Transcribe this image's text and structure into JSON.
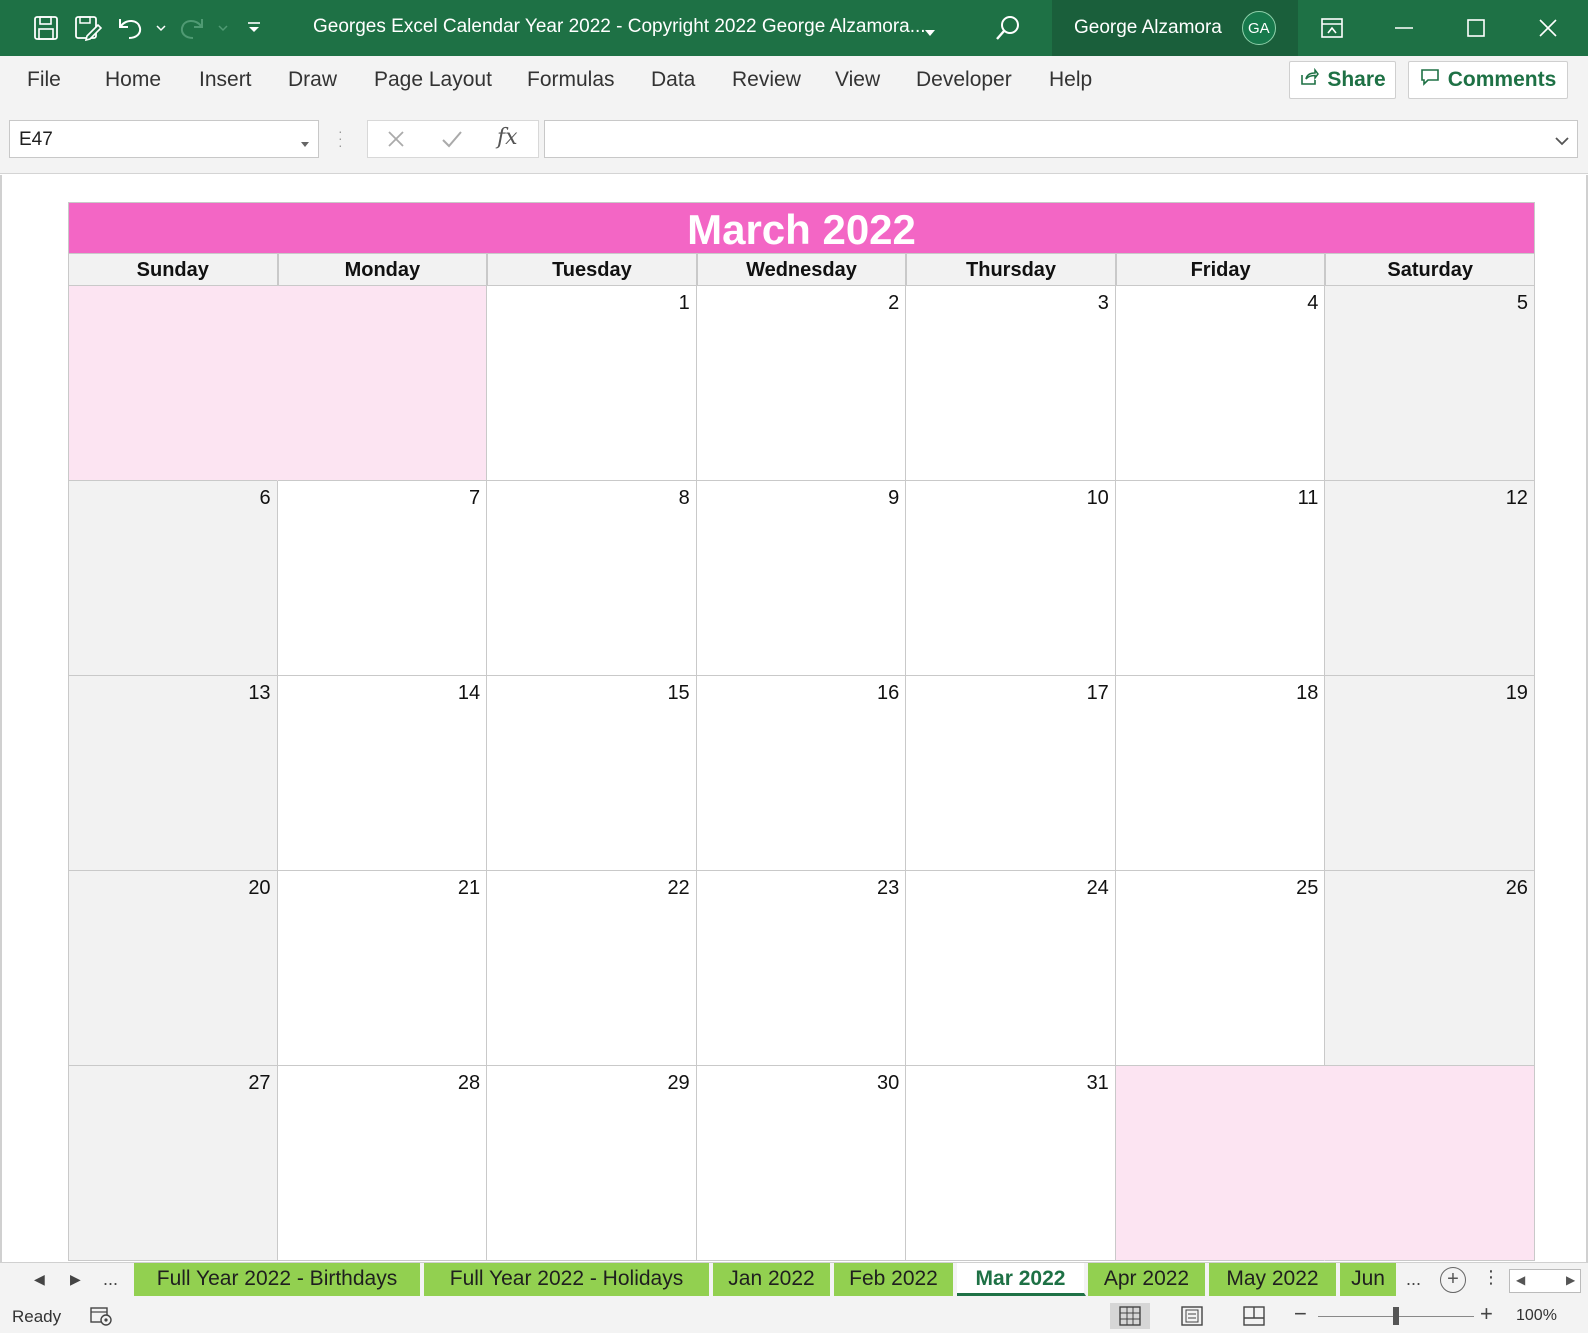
{
  "titlebar": {
    "document_title": "Georges Excel Calendar Year 2022 - Copyright 2022 George Alzamora...",
    "user_name": "George Alzamora",
    "user_initials": "GA",
    "qat_icons": [
      "save-icon",
      "autosave-icon",
      "undo-icon",
      "redo-icon",
      "customize-qat-icon"
    ],
    "window_icons": [
      "ribbon-display-icon",
      "minimize-icon",
      "maximize-icon",
      "close-icon"
    ]
  },
  "ribbon": {
    "tabs": [
      "File",
      "Home",
      "Insert",
      "Draw",
      "Page Layout",
      "Formulas",
      "Data",
      "Review",
      "View",
      "Developer",
      "Help"
    ],
    "share_label": "Share",
    "comments_label": "Comments"
  },
  "formula_bar": {
    "name_box": "E47",
    "fx_label": "fx",
    "formula": ""
  },
  "calendar": {
    "title": "March 2022",
    "title_color": "#f366c5",
    "blank_color": "#fce4f2",
    "weekend_color": "#f2f2f2",
    "days_of_week": [
      "Sunday",
      "Monday",
      "Tuesday",
      "Wednesday",
      "Thursday",
      "Friday",
      "Saturday"
    ],
    "weeks": [
      [
        "",
        "",
        "1",
        "2",
        "3",
        "4",
        "5"
      ],
      [
        "6",
        "7",
        "8",
        "9",
        "10",
        "11",
        "12"
      ],
      [
        "13",
        "14",
        "15",
        "16",
        "17",
        "18",
        "19"
      ],
      [
        "20",
        "21",
        "22",
        "23",
        "24",
        "25",
        "26"
      ],
      [
        "27",
        "28",
        "29",
        "30",
        "31",
        "",
        ""
      ]
    ]
  },
  "sheet_tabs": {
    "ellipsis": "...",
    "tabs": [
      "Full Year 2022 - Birthdays",
      "Full Year 2022 - Holidays",
      "Jan 2022",
      "Feb 2022",
      "Mar 2022",
      "Apr 2022",
      "May 2022",
      "Jun"
    ],
    "active": "Mar 2022",
    "tab_color": "#92d050",
    "add_label": "+"
  },
  "status_bar": {
    "status": "Ready",
    "zoom_minus": "−",
    "zoom_plus": "+",
    "zoom": "100%",
    "zoom_fraction": 0.5
  }
}
